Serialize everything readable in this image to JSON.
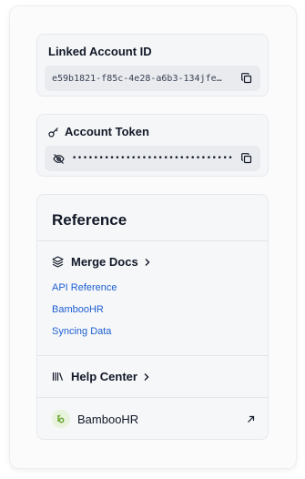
{
  "linked_account": {
    "title": "Linked Account ID",
    "value": "e59b1821-f85c-4e28-a6b3-134jfe…"
  },
  "account_token": {
    "title": "Account Token",
    "masked_value": "••••••••••••••••••••••••••••••"
  },
  "reference": {
    "title": "Reference",
    "merge_docs": {
      "label": "Merge Docs",
      "links": [
        "API Reference",
        "BambooHR",
        "Syncing Data"
      ]
    },
    "help_center": {
      "label": "Help Center"
    },
    "integration": {
      "label": "BambooHR"
    }
  },
  "colors": {
    "link": "#1d5fd1",
    "card_bg": "#f5f6f8",
    "field_bg": "#e9ebef",
    "logo_green": "#6aa832"
  }
}
